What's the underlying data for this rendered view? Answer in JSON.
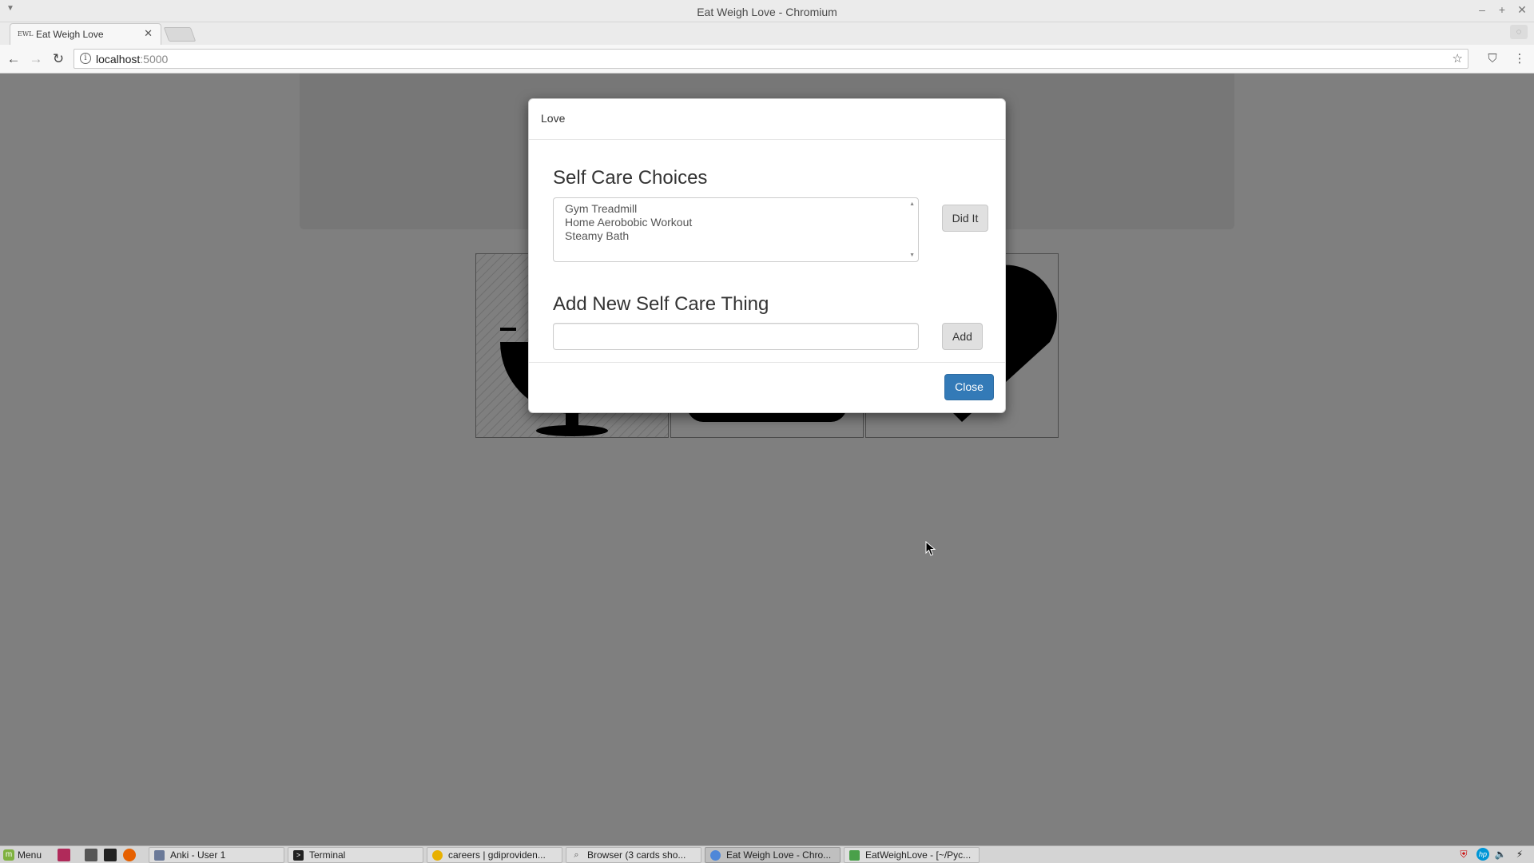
{
  "window": {
    "title": "Eat Weigh Love - Chromium",
    "minimize": "–",
    "maximize": "+",
    "close": "✕"
  },
  "tabs": [
    {
      "favicon": "EWL",
      "title": "Eat Weigh Love",
      "close": "✕"
    }
  ],
  "toolbar": {
    "back": "←",
    "forward": "→",
    "reload": "↻",
    "info": "i",
    "url_host": "localhost",
    "url_port": ":5000",
    "bookmark": "☆",
    "menu": "⋮"
  },
  "modal": {
    "title": "Love",
    "choices_heading": "Self Care Choices",
    "choices": [
      "Gym Treadmill",
      "Home Aerobobic Workout",
      "Steamy Bath"
    ],
    "did_it_label": "Did It",
    "add_heading": "Add New Self Care Thing",
    "add_input_value": "",
    "add_label": "Add",
    "close_label": "Close"
  },
  "taskbar": {
    "menu_label": "Menu",
    "tasks": [
      {
        "label": "Anki - User 1",
        "icon": "anki-icon"
      },
      {
        "label": "Terminal",
        "icon": "terminal-icon"
      },
      {
        "label": "careers | gdiproviden...",
        "icon": "chrome-icon"
      },
      {
        "label": "Browser (3 cards sho...",
        "icon": "search-icon"
      },
      {
        "label": "Eat Weigh Love - Chro...",
        "icon": "chromium-icon"
      },
      {
        "label": "EatWeighLove - [~/Pyc...",
        "icon": "pycharm-icon"
      }
    ]
  },
  "colors": {
    "primary_button": "#337ab7",
    "backdrop": "#7f7f7f"
  }
}
